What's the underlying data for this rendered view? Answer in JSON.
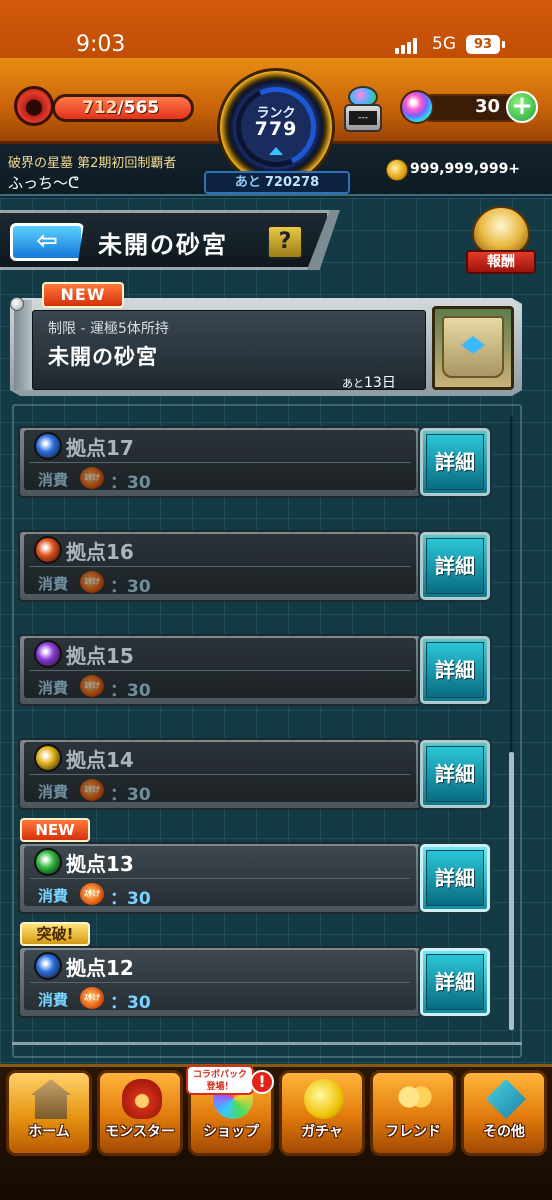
{
  "status": {
    "time": "9:03",
    "network": "5G",
    "battery": "93"
  },
  "hud": {
    "stamina_current": "712",
    "stamina_max": "/565",
    "rank_label": "ランク",
    "rank_value": "779",
    "exp_prefix": "あと",
    "exp_remaining": "720278",
    "robot_screen": "---",
    "orb_count": "30",
    "orb_plus": "+",
    "title": "破界の星墓 第2期初回制覇者",
    "player_name": "ふっち〜ᕦ",
    "gold": "999,999,999+"
  },
  "header": {
    "back_icon": "left-arrow-icon",
    "title": "未開の砂宮",
    "help_label": "?",
    "reward_label": "報酬"
  },
  "quest": {
    "new_label": "NEW",
    "limit_text": "制限 - 運極5体所持",
    "name": "未開の砂宮",
    "remaining_prefix": "あと",
    "remaining_days": "13日"
  },
  "stages": [
    {
      "name": "拠点17",
      "cost_label": "消費",
      "stamina_icon_text": "ｽﾀﾐﾅ",
      "cost": "：30",
      "detail_label": "詳細",
      "element": "water",
      "color": "#2a6fe0"
    },
    {
      "name": "拠点16",
      "cost_label": "消費",
      "stamina_icon_text": "ｽﾀﾐﾅ",
      "cost": "：30",
      "detail_label": "詳細",
      "element": "fire",
      "color": "#e0501a"
    },
    {
      "name": "拠点15",
      "cost_label": "消費",
      "stamina_icon_text": "ｽﾀﾐﾅ",
      "cost": "：30",
      "detail_label": "詳細",
      "element": "dark",
      "color": "#8a3ad8"
    },
    {
      "name": "拠点14",
      "cost_label": "消費",
      "stamina_icon_text": "ｽﾀﾐﾅ",
      "cost": "：30",
      "detail_label": "詳細",
      "element": "light",
      "color": "#e0b21a"
    },
    {
      "name": "拠点13",
      "cost_label": "消費",
      "stamina_icon_text": "ｽﾀﾐﾅ",
      "cost": "：30",
      "detail_label": "詳細",
      "element": "wood",
      "color": "#2fb83c"
    },
    {
      "name": "拠点12",
      "cost_label": "消費",
      "stamina_icon_text": "ｽﾀﾐﾅ",
      "cost": "：30",
      "detail_label": "詳細",
      "element": "water",
      "color": "#2a6fe0"
    }
  ],
  "stage_tags": {
    "new": "NEW",
    "break": "突破!"
  },
  "nav": {
    "collab_badge": "コラボパック\n登場！",
    "alert": "!",
    "items": [
      {
        "label": "ホーム",
        "icon": "home-icon"
      },
      {
        "label": "モンスター",
        "icon": "monster-icon"
      },
      {
        "label": "ショップ",
        "icon": "shop-icon"
      },
      {
        "label": "ガチャ",
        "icon": "gacha-icon"
      },
      {
        "label": "フレンド",
        "icon": "friend-icon"
      },
      {
        "label": "その他",
        "icon": "other-icon"
      }
    ]
  },
  "stamina_fill_fraction": 1.0
}
